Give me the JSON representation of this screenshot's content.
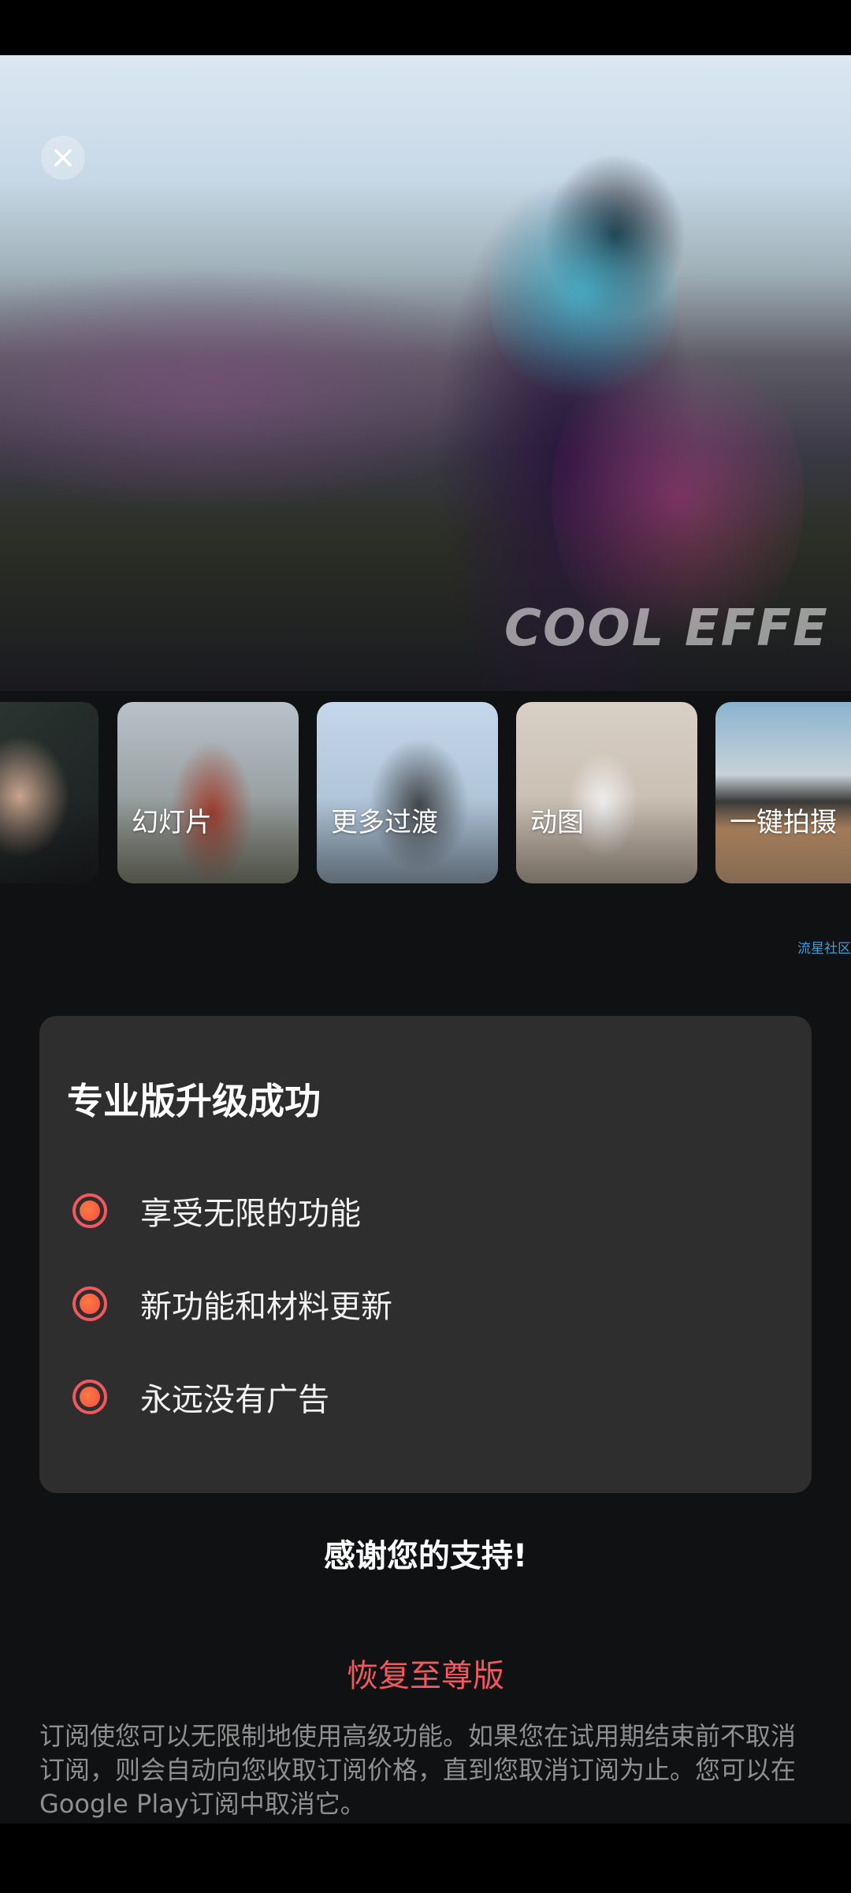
{
  "hero": {
    "watermark_text": "COOL EFFE",
    "close_icon": "close-icon"
  },
  "features": [
    {
      "label": ""
    },
    {
      "label": "幻灯片"
    },
    {
      "label": "更多过渡"
    },
    {
      "label": "动图"
    },
    {
      "label": "一键拍摄"
    }
  ],
  "community_link": "流星社区",
  "pro_card": {
    "title": "专业版升级成功",
    "benefits": [
      {
        "text": "享受无限的功能",
        "icon": "radio-dot-icon"
      },
      {
        "text": "新功能和材料更新",
        "icon": "radio-dot-icon"
      },
      {
        "text": "永远没有广告",
        "icon": "radio-dot-icon"
      }
    ]
  },
  "thanks": "感谢您的支持!",
  "restore_button": "恢复至尊版",
  "disclaimer": "订阅使您可以无限制地使用高级功能。如果您在试用期结束前不取消订阅，则会自动向您收取订阅价格，直到您取消订阅为止。您可以在Google Play订阅中取消它。",
  "colors": {
    "accent": "#f2595f",
    "card_bg": "#2e2e2f",
    "page_bg": "#0f1112",
    "link": "#3a9fe0"
  }
}
